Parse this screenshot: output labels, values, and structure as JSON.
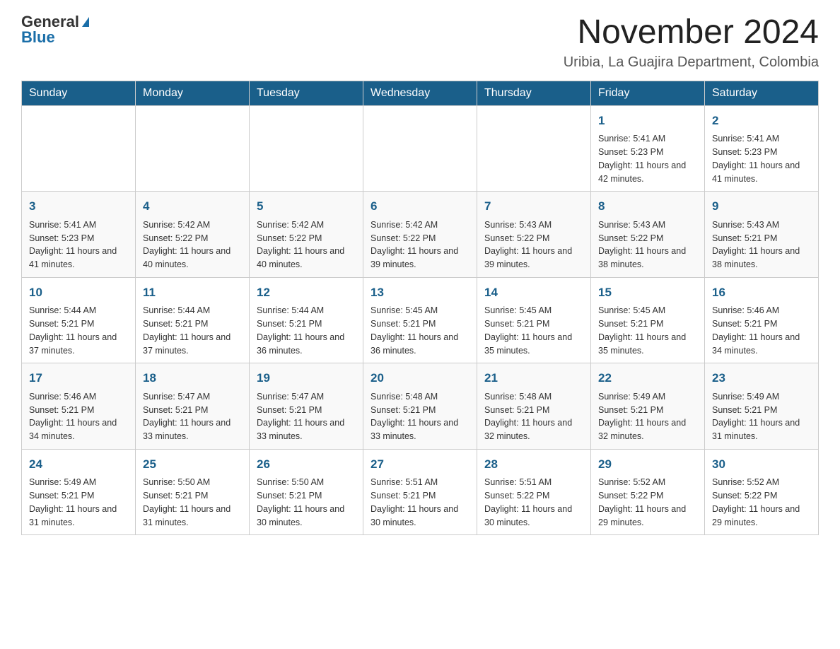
{
  "header": {
    "logo_general": "General",
    "logo_blue": "Blue",
    "month_title": "November 2024",
    "location": "Uribia, La Guajira Department, Colombia"
  },
  "days_of_week": [
    "Sunday",
    "Monday",
    "Tuesday",
    "Wednesday",
    "Thursday",
    "Friday",
    "Saturday"
  ],
  "weeks": [
    [
      {
        "day": "",
        "info": ""
      },
      {
        "day": "",
        "info": ""
      },
      {
        "day": "",
        "info": ""
      },
      {
        "day": "",
        "info": ""
      },
      {
        "day": "",
        "info": ""
      },
      {
        "day": "1",
        "info": "Sunrise: 5:41 AM\nSunset: 5:23 PM\nDaylight: 11 hours and 42 minutes."
      },
      {
        "day": "2",
        "info": "Sunrise: 5:41 AM\nSunset: 5:23 PM\nDaylight: 11 hours and 41 minutes."
      }
    ],
    [
      {
        "day": "3",
        "info": "Sunrise: 5:41 AM\nSunset: 5:23 PM\nDaylight: 11 hours and 41 minutes."
      },
      {
        "day": "4",
        "info": "Sunrise: 5:42 AM\nSunset: 5:22 PM\nDaylight: 11 hours and 40 minutes."
      },
      {
        "day": "5",
        "info": "Sunrise: 5:42 AM\nSunset: 5:22 PM\nDaylight: 11 hours and 40 minutes."
      },
      {
        "day": "6",
        "info": "Sunrise: 5:42 AM\nSunset: 5:22 PM\nDaylight: 11 hours and 39 minutes."
      },
      {
        "day": "7",
        "info": "Sunrise: 5:43 AM\nSunset: 5:22 PM\nDaylight: 11 hours and 39 minutes."
      },
      {
        "day": "8",
        "info": "Sunrise: 5:43 AM\nSunset: 5:22 PM\nDaylight: 11 hours and 38 minutes."
      },
      {
        "day": "9",
        "info": "Sunrise: 5:43 AM\nSunset: 5:21 PM\nDaylight: 11 hours and 38 minutes."
      }
    ],
    [
      {
        "day": "10",
        "info": "Sunrise: 5:44 AM\nSunset: 5:21 PM\nDaylight: 11 hours and 37 minutes."
      },
      {
        "day": "11",
        "info": "Sunrise: 5:44 AM\nSunset: 5:21 PM\nDaylight: 11 hours and 37 minutes."
      },
      {
        "day": "12",
        "info": "Sunrise: 5:44 AM\nSunset: 5:21 PM\nDaylight: 11 hours and 36 minutes."
      },
      {
        "day": "13",
        "info": "Sunrise: 5:45 AM\nSunset: 5:21 PM\nDaylight: 11 hours and 36 minutes."
      },
      {
        "day": "14",
        "info": "Sunrise: 5:45 AM\nSunset: 5:21 PM\nDaylight: 11 hours and 35 minutes."
      },
      {
        "day": "15",
        "info": "Sunrise: 5:45 AM\nSunset: 5:21 PM\nDaylight: 11 hours and 35 minutes."
      },
      {
        "day": "16",
        "info": "Sunrise: 5:46 AM\nSunset: 5:21 PM\nDaylight: 11 hours and 34 minutes."
      }
    ],
    [
      {
        "day": "17",
        "info": "Sunrise: 5:46 AM\nSunset: 5:21 PM\nDaylight: 11 hours and 34 minutes."
      },
      {
        "day": "18",
        "info": "Sunrise: 5:47 AM\nSunset: 5:21 PM\nDaylight: 11 hours and 33 minutes."
      },
      {
        "day": "19",
        "info": "Sunrise: 5:47 AM\nSunset: 5:21 PM\nDaylight: 11 hours and 33 minutes."
      },
      {
        "day": "20",
        "info": "Sunrise: 5:48 AM\nSunset: 5:21 PM\nDaylight: 11 hours and 33 minutes."
      },
      {
        "day": "21",
        "info": "Sunrise: 5:48 AM\nSunset: 5:21 PM\nDaylight: 11 hours and 32 minutes."
      },
      {
        "day": "22",
        "info": "Sunrise: 5:49 AM\nSunset: 5:21 PM\nDaylight: 11 hours and 32 minutes."
      },
      {
        "day": "23",
        "info": "Sunrise: 5:49 AM\nSunset: 5:21 PM\nDaylight: 11 hours and 31 minutes."
      }
    ],
    [
      {
        "day": "24",
        "info": "Sunrise: 5:49 AM\nSunset: 5:21 PM\nDaylight: 11 hours and 31 minutes."
      },
      {
        "day": "25",
        "info": "Sunrise: 5:50 AM\nSunset: 5:21 PM\nDaylight: 11 hours and 31 minutes."
      },
      {
        "day": "26",
        "info": "Sunrise: 5:50 AM\nSunset: 5:21 PM\nDaylight: 11 hours and 30 minutes."
      },
      {
        "day": "27",
        "info": "Sunrise: 5:51 AM\nSunset: 5:21 PM\nDaylight: 11 hours and 30 minutes."
      },
      {
        "day": "28",
        "info": "Sunrise: 5:51 AM\nSunset: 5:22 PM\nDaylight: 11 hours and 30 minutes."
      },
      {
        "day": "29",
        "info": "Sunrise: 5:52 AM\nSunset: 5:22 PM\nDaylight: 11 hours and 29 minutes."
      },
      {
        "day": "30",
        "info": "Sunrise: 5:52 AM\nSunset: 5:22 PM\nDaylight: 11 hours and 29 minutes."
      }
    ]
  ]
}
